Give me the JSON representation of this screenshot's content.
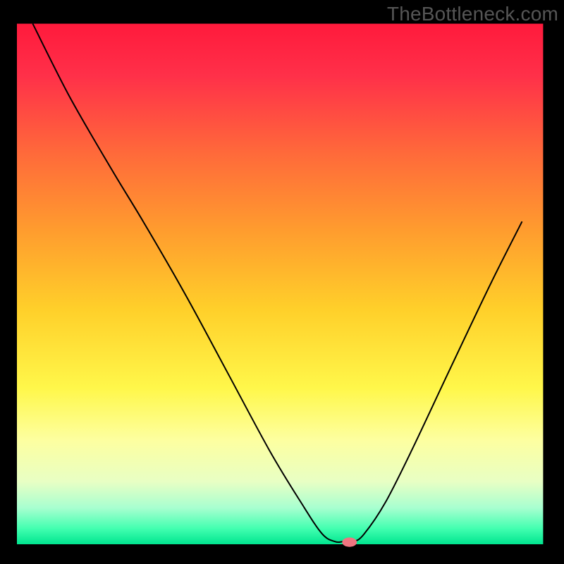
{
  "watermark": "TheBottleneck.com",
  "chart_data": {
    "type": "line",
    "title": "",
    "xlabel": "",
    "ylabel": "",
    "xlim": [
      0,
      100
    ],
    "ylim": [
      0,
      100
    ],
    "grid": false,
    "legend": false,
    "background": {
      "kind": "vertical-gradient",
      "stops": [
        {
          "pos": 0.0,
          "color": "#ff1a3c"
        },
        {
          "pos": 0.1,
          "color": "#ff3049"
        },
        {
          "pos": 0.25,
          "color": "#ff6a3a"
        },
        {
          "pos": 0.4,
          "color": "#ff9d2e"
        },
        {
          "pos": 0.55,
          "color": "#ffd02a"
        },
        {
          "pos": 0.7,
          "color": "#fff74a"
        },
        {
          "pos": 0.8,
          "color": "#fdffa0"
        },
        {
          "pos": 0.88,
          "color": "#e8ffc4"
        },
        {
          "pos": 0.93,
          "color": "#a8ffd0"
        },
        {
          "pos": 0.97,
          "color": "#42ffb0"
        },
        {
          "pos": 1.0,
          "color": "#00e58f"
        }
      ]
    },
    "series": [
      {
        "name": "bottleneck-curve",
        "color": "#000000",
        "width": 2,
        "x": [
          3,
          10,
          18,
          24,
          32,
          40,
          48,
          54,
          58,
          60.5,
          62,
          64,
          66,
          70,
          75,
          82,
          90,
          96
        ],
        "y": [
          100,
          86,
          72,
          62,
          48,
          33,
          18,
          8,
          2,
          0.5,
          0.5,
          0.5,
          2,
          8,
          18,
          33,
          50,
          62
        ]
      }
    ],
    "marker": {
      "name": "optimum-marker",
      "shape": "pill",
      "color": "#ef7580",
      "x": 63.2,
      "y": 0.4,
      "rx_pct": 1.4,
      "ry_pct": 0.9
    },
    "frame": {
      "left_pct": 3.0,
      "right_pct": 3.7,
      "top_pct": 4.2,
      "bottom_pct": 3.5
    }
  }
}
